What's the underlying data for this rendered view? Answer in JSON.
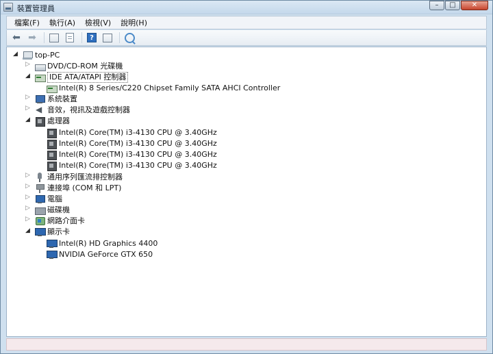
{
  "window": {
    "title": "裝置管理員"
  },
  "menu": [
    "檔案(F)",
    "執行(A)",
    "檢視(V)",
    "說明(H)"
  ],
  "toolbar": {
    "back_icon": "back-arrow-icon",
    "forward_icon": "forward-arrow-icon"
  },
  "tree": {
    "root": "top-PC",
    "nodes": [
      {
        "label": "DVD/CD-ROM 光碟機",
        "expanded": false,
        "icon": "dvd-drive-icon"
      },
      {
        "label": "IDE ATA/ATAPI 控制器",
        "expanded": true,
        "selected": true,
        "icon": "ide-controller-icon",
        "children": [
          "Intel(R) 8 Series/C220 Chipset Family SATA AHCI Controller"
        ]
      },
      {
        "label": "系統裝置",
        "expanded": false,
        "icon": "system-device-icon"
      },
      {
        "label": "音效，視訊及遊戲控制器",
        "expanded": false,
        "icon": "audio-icon"
      },
      {
        "label": "處理器",
        "expanded": true,
        "icon": "processor-icon",
        "children": [
          "Intel(R) Core(TM) i3-4130 CPU @ 3.40GHz",
          "Intel(R) Core(TM) i3-4130 CPU @ 3.40GHz",
          "Intel(R) Core(TM) i3-4130 CPU @ 3.40GHz",
          "Intel(R) Core(TM) i3-4130 CPU @ 3.40GHz"
        ]
      },
      {
        "label": "通用序列匯流排控制器",
        "expanded": false,
        "icon": "usb-icon"
      },
      {
        "label": "連接埠 (COM 和 LPT)",
        "expanded": false,
        "icon": "port-icon"
      },
      {
        "label": "電腦",
        "expanded": false,
        "icon": "computer-icon"
      },
      {
        "label": "磁碟機",
        "expanded": false,
        "icon": "disk-drive-icon"
      },
      {
        "label": "網路介面卡",
        "expanded": false,
        "icon": "network-adapter-icon"
      },
      {
        "label": "顯示卡",
        "expanded": true,
        "icon": "display-adapter-icon",
        "children": [
          "Intel(R) HD Graphics 4400",
          "NVIDIA GeForce GTX 650"
        ]
      }
    ]
  }
}
